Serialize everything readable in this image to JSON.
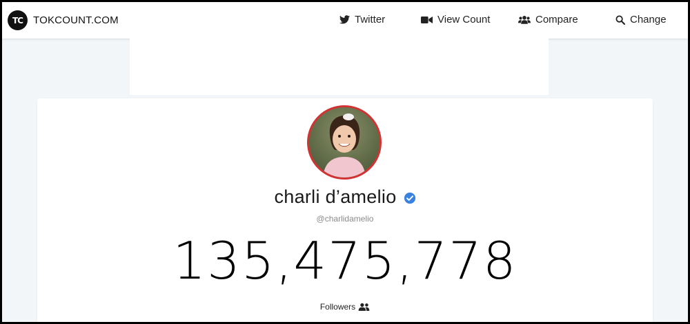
{
  "brand": {
    "logo_text": "TC",
    "name": "TOKCOUNT.COM"
  },
  "nav": {
    "items": [
      {
        "label": "Twitter",
        "icon": "twitter-icon"
      },
      {
        "label": "View Count",
        "icon": "video-camera-icon"
      },
      {
        "label": "Compare",
        "icon": "users-icon"
      },
      {
        "label": "Change",
        "icon": "search-icon"
      }
    ]
  },
  "profile": {
    "display_name": "charli d’amelio",
    "handle": "@charlidamelio",
    "verified": true,
    "follower_count": "135,475,778",
    "count_label": "Followers"
  },
  "colors": {
    "avatar_ring": "#d23232",
    "verified_badge": "#3b82e0",
    "page_background": "#f3f6f9"
  }
}
